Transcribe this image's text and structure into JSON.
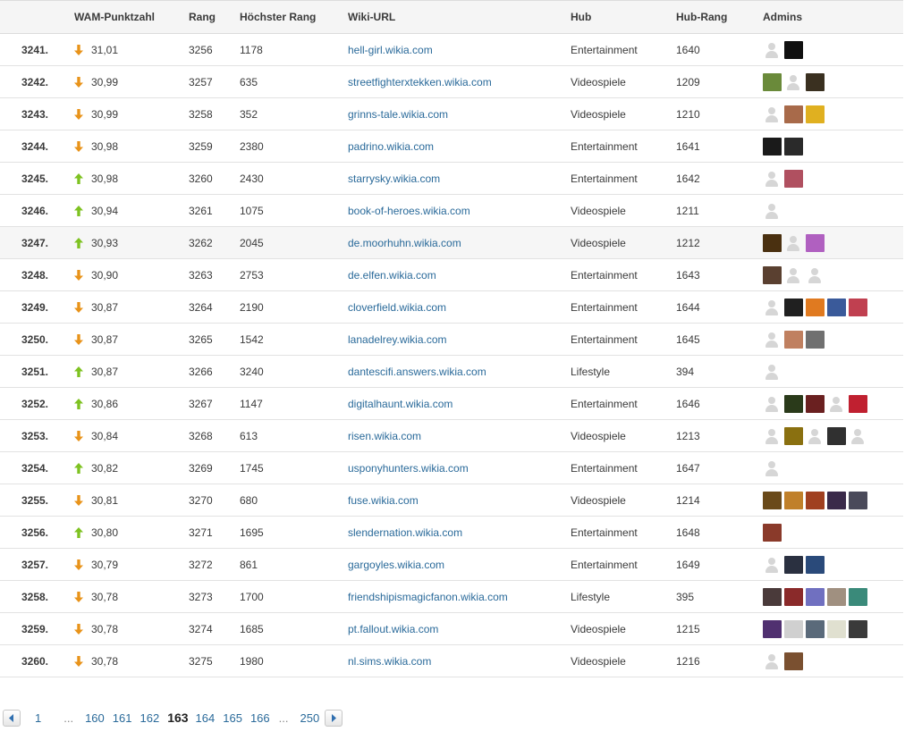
{
  "table": {
    "headers": {
      "position": "",
      "score": "WAM-Punktzahl",
      "rank": "Rang",
      "peak_rank": "Höchster Rang",
      "url": "Wiki-URL",
      "hub": "Hub",
      "hub_rank": "Hub-Rang",
      "admins": "Admins"
    },
    "rows": [
      {
        "pos": "3241.",
        "trend": "down",
        "score": "31,01",
        "rank": "3256",
        "peak": "1178",
        "url": "hell-girl.wikia.com",
        "hub": "Entertainment",
        "hub_rank": "1640",
        "admins": [
          "placeholder",
          "#101010"
        ]
      },
      {
        "pos": "3242.",
        "trend": "down",
        "score": "30,99",
        "rank": "3257",
        "peak": "635",
        "url": "streetfighterxtekken.wikia.com",
        "hub": "Videospiele",
        "hub_rank": "1209",
        "admins": [
          "#6a8a3a",
          "placeholder",
          "#3a3020"
        ]
      },
      {
        "pos": "3243.",
        "trend": "down",
        "score": "30,99",
        "rank": "3258",
        "peak": "352",
        "url": "grinns-tale.wikia.com",
        "hub": "Videospiele",
        "hub_rank": "1210",
        "admins": [
          "placeholder",
          "#a86a4a",
          "#e0b020"
        ]
      },
      {
        "pos": "3244.",
        "trend": "down",
        "score": "30,98",
        "rank": "3259",
        "peak": "2380",
        "url": "padrino.wikia.com",
        "hub": "Entertainment",
        "hub_rank": "1641",
        "admins": [
          "#1a1a1a",
          "#2a2a2a"
        ]
      },
      {
        "pos": "3245.",
        "trend": "up",
        "score": "30,98",
        "rank": "3260",
        "peak": "2430",
        "url": "starrysky.wikia.com",
        "hub": "Entertainment",
        "hub_rank": "1642",
        "admins": [
          "placeholder",
          "#b05060"
        ]
      },
      {
        "pos": "3246.",
        "trend": "up",
        "score": "30,94",
        "rank": "3261",
        "peak": "1075",
        "url": "book-of-heroes.wikia.com",
        "hub": "Videospiele",
        "hub_rank": "1211",
        "admins": [
          "placeholder"
        ]
      },
      {
        "pos": "3247.",
        "trend": "up",
        "score": "30,93",
        "rank": "3262",
        "peak": "2045",
        "url": "de.moorhuhn.wikia.com",
        "hub": "Videospiele",
        "hub_rank": "1212",
        "admins": [
          "#4a3010",
          "placeholder",
          "#b060c0"
        ],
        "highlight": true
      },
      {
        "pos": "3248.",
        "trend": "down",
        "score": "30,90",
        "rank": "3263",
        "peak": "2753",
        "url": "de.elfen.wikia.com",
        "hub": "Entertainment",
        "hub_rank": "1643",
        "admins": [
          "#5a4030",
          "placeholder",
          "placeholder"
        ]
      },
      {
        "pos": "3249.",
        "trend": "down",
        "score": "30,87",
        "rank": "3264",
        "peak": "2190",
        "url": "cloverfield.wikia.com",
        "hub": "Entertainment",
        "hub_rank": "1644",
        "admins": [
          "placeholder",
          "#202020",
          "#e07a20",
          "#3a5a9a",
          "#c04050"
        ]
      },
      {
        "pos": "3250.",
        "trend": "down",
        "score": "30,87",
        "rank": "3265",
        "peak": "1542",
        "url": "lanadelrey.wikia.com",
        "hub": "Entertainment",
        "hub_rank": "1645",
        "admins": [
          "placeholder",
          "#c08060",
          "#707070"
        ]
      },
      {
        "pos": "3251.",
        "trend": "up",
        "score": "30,87",
        "rank": "3266",
        "peak": "3240",
        "url": "dantescifi.answers.wikia.com",
        "hub": "Lifestyle",
        "hub_rank": "394",
        "admins": [
          "placeholder"
        ]
      },
      {
        "pos": "3252.",
        "trend": "up",
        "score": "30,86",
        "rank": "3267",
        "peak": "1147",
        "url": "digitalhaunt.wikia.com",
        "hub": "Entertainment",
        "hub_rank": "1646",
        "admins": [
          "placeholder",
          "#2a3a1a",
          "#6a2020",
          "placeholder",
          "#c02030"
        ]
      },
      {
        "pos": "3253.",
        "trend": "down",
        "score": "30,84",
        "rank": "3268",
        "peak": "613",
        "url": "risen.wikia.com",
        "hub": "Videospiele",
        "hub_rank": "1213",
        "admins": [
          "placeholder",
          "#8a7010",
          "placeholder",
          "#303030",
          "placeholder"
        ]
      },
      {
        "pos": "3254.",
        "trend": "up",
        "score": "30,82",
        "rank": "3269",
        "peak": "1745",
        "url": "usponyhunters.wikia.com",
        "hub": "Entertainment",
        "hub_rank": "1647",
        "admins": [
          "placeholder"
        ]
      },
      {
        "pos": "3255.",
        "trend": "down",
        "score": "30,81",
        "rank": "3270",
        "peak": "680",
        "url": "fuse.wikia.com",
        "hub": "Videospiele",
        "hub_rank": "1214",
        "admins": [
          "#6a4a1a",
          "#c0802a",
          "#a04020",
          "#3a2a4a",
          "#4a4a5a"
        ]
      },
      {
        "pos": "3256.",
        "trend": "up",
        "score": "30,80",
        "rank": "3271",
        "peak": "1695",
        "url": "slendernation.wikia.com",
        "hub": "Entertainment",
        "hub_rank": "1648",
        "admins": [
          "#8a3a2a"
        ]
      },
      {
        "pos": "3257.",
        "trend": "down",
        "score": "30,79",
        "rank": "3272",
        "peak": "861",
        "url": "gargoyles.wikia.com",
        "hub": "Entertainment",
        "hub_rank": "1649",
        "admins": [
          "placeholder",
          "#2a3040",
          "#2a4a7a"
        ]
      },
      {
        "pos": "3258.",
        "trend": "down",
        "score": "30,78",
        "rank": "3273",
        "peak": "1700",
        "url": "friendshipismagicfanon.wikia.com",
        "hub": "Lifestyle",
        "hub_rank": "395",
        "admins": [
          "#4a3a3a",
          "#8a2a2a",
          "#7070c0",
          "#a09080",
          "#3a8a7a"
        ]
      },
      {
        "pos": "3259.",
        "trend": "down",
        "score": "30,78",
        "rank": "3274",
        "peak": "1685",
        "url": "pt.fallout.wikia.com",
        "hub": "Videospiele",
        "hub_rank": "1215",
        "admins": [
          "#503070",
          "#d0d0d0",
          "#5a6a7a",
          "#e0e0d0",
          "#3a3a3a"
        ]
      },
      {
        "pos": "3260.",
        "trend": "down",
        "score": "30,78",
        "rank": "3275",
        "peak": "1980",
        "url": "nl.sims.wikia.com",
        "hub": "Videospiele",
        "hub_rank": "1216",
        "admins": [
          "placeholder",
          "#7a5030"
        ]
      }
    ]
  },
  "pagination": {
    "first": "1",
    "dots1": "...",
    "pages": [
      "160",
      "161",
      "162"
    ],
    "current": "163",
    "pages_after": [
      "164",
      "165",
      "166"
    ],
    "dots2": "...",
    "last": "250"
  },
  "colors": {
    "down_arrow": "#e8931a",
    "up_arrow": "#7ec221",
    "link": "#2a6a9a",
    "pager_arrow": "#2f6fb0"
  }
}
